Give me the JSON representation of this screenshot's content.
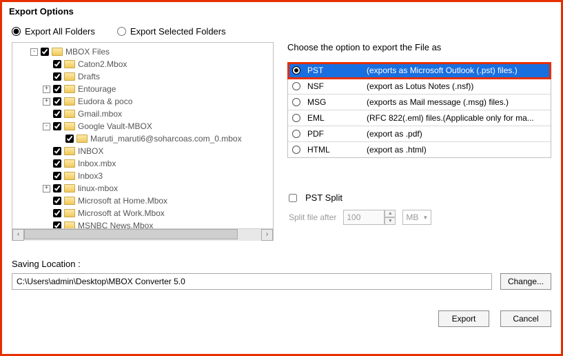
{
  "title": "Export Options",
  "radios": {
    "all": "Export All Folders",
    "selected": "Export Selected Folders"
  },
  "tree": [
    {
      "indent": 0,
      "expand": "-",
      "label": "MBOX Files"
    },
    {
      "indent": 1,
      "expand": "",
      "label": "Caton2.Mbox"
    },
    {
      "indent": 1,
      "expand": "",
      "label": "Drafts"
    },
    {
      "indent": 1,
      "expand": "+",
      "label": "Entourage"
    },
    {
      "indent": 1,
      "expand": "+",
      "label": "Eudora & poco"
    },
    {
      "indent": 1,
      "expand": "",
      "label": "Gmail.mbox"
    },
    {
      "indent": 1,
      "expand": "-",
      "label": "Google Vault-MBOX"
    },
    {
      "indent": 2,
      "expand": "",
      "label": "Maruti_maruti6@soharcoas.com_0.mbox"
    },
    {
      "indent": 1,
      "expand": "",
      "label": "INBOX"
    },
    {
      "indent": 1,
      "expand": "",
      "label": "Inbox.mbx"
    },
    {
      "indent": 1,
      "expand": "",
      "label": "Inbox3"
    },
    {
      "indent": 1,
      "expand": "+",
      "label": "linux-mbox"
    },
    {
      "indent": 1,
      "expand": "",
      "label": "Microsoft at Home.Mbox"
    },
    {
      "indent": 1,
      "expand": "",
      "label": "Microsoft at Work.Mbox"
    },
    {
      "indent": 1,
      "expand": "",
      "label": "MSNBC News.Mbox"
    }
  ],
  "choose_label": "Choose the option to export the File as",
  "formats": [
    {
      "name": "PST",
      "desc": "(exports as Microsoft Outlook (.pst) files.)",
      "selected": true
    },
    {
      "name": "NSF",
      "desc": "(export as Lotus Notes (.nsf))",
      "selected": false
    },
    {
      "name": "MSG",
      "desc": "(exports as Mail message (.msg) files.)",
      "selected": false
    },
    {
      "name": "EML",
      "desc": "(RFC 822(.eml) files.(Applicable only for ma...",
      "selected": false
    },
    {
      "name": "PDF",
      "desc": "(export as .pdf)",
      "selected": false
    },
    {
      "name": "HTML",
      "desc": "(export as .html)",
      "selected": false
    }
  ],
  "pst_split": {
    "label": "PST Split",
    "after_label": "Split file after",
    "value": "100",
    "unit": "MB"
  },
  "save": {
    "label": "Saving Location :",
    "path": "C:\\Users\\admin\\Desktop\\MBOX Converter 5.0",
    "change": "Change..."
  },
  "buttons": {
    "export": "Export",
    "cancel": "Cancel"
  }
}
